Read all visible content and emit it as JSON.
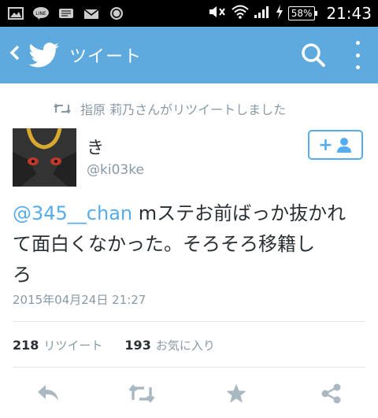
{
  "status_bar": {
    "notification_icons": [
      "image-icon",
      "line-icon",
      "app-icon",
      "mail-icon",
      "app-icon"
    ],
    "line_label": "LINE",
    "battery": "58%",
    "time": "21:43"
  },
  "app_bar": {
    "title": "ツイート",
    "color": "#5ea9dd"
  },
  "retweet_notice": "指原 莉乃さんがリツイートしました",
  "tweet": {
    "display_name": "き",
    "handle": "@ki03ke",
    "mention": "@345__chan",
    "body_line1": " mステお前ばっか抜かれ",
    "body_line2": "て面白くなかった。そろそろ移籍し",
    "body_line3": "ろ",
    "timestamp": "2015年04月24日 21:27",
    "retweet_count": "218",
    "retweet_label": "リツイート",
    "favorite_count": "193",
    "favorite_label": "お気に入り"
  },
  "accent_color": "#55acee"
}
